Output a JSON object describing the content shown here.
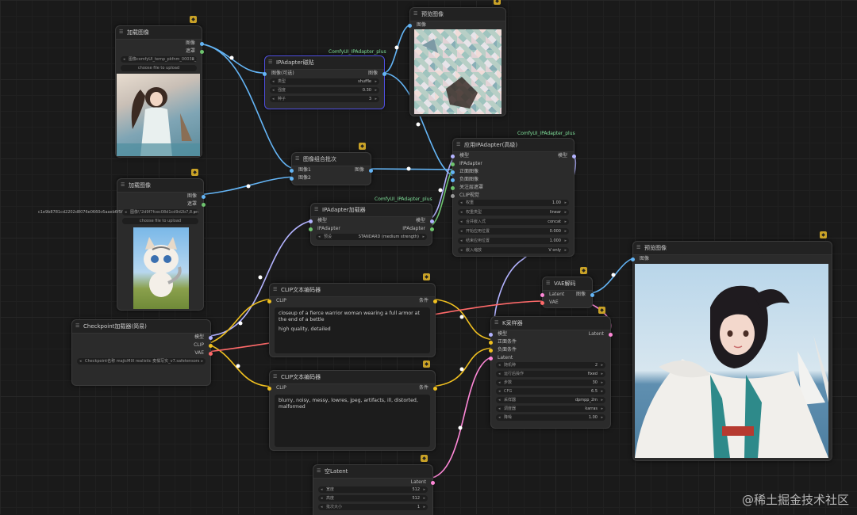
{
  "nodes": {
    "load1": {
      "title": "加载图像",
      "outputs": [
        "图像",
        "遮罩"
      ],
      "file": "图像comfyUI_temp_pkfnm_00038_.png",
      "upload": "choose file to upload"
    },
    "load2": {
      "title": "加载图像",
      "outputs": [
        "图像",
        "遮罩"
      ],
      "file_overflow": "c1e9b8781cd2202d8076e0660c6aaeb6f5f8a6",
      "file": "图像\\\"2d9f7fcec08d1cd9d2b7,8.png",
      "upload": "choose file to upload"
    },
    "preview1": {
      "title": "预览图像",
      "input": "图像"
    },
    "preview2": {
      "title": "预览图像",
      "input": "图像"
    },
    "ipa_tile": {
      "title": "IPAdapter磁贴",
      "tag": "ComfyUI_IPAdapter_plus",
      "input": "图像(可选)",
      "output": "图像",
      "widgets": [
        {
          "label": "类型",
          "value": "shuffle"
        },
        {
          "label": "强度",
          "value": "0.30"
        },
        {
          "label": "种子",
          "value": "3"
        }
      ]
    },
    "batch": {
      "title": "图像组合批次",
      "inputs": [
        "图像1",
        "图像2"
      ],
      "output": "图像"
    },
    "ipa_adv": {
      "title": "应用IPAdapter(高级)",
      "tag": "ComfyUI_IPAdapter_plus",
      "inputs": [
        "模型",
        "IPAdapter",
        "正面图像",
        "负面图像",
        "关注层遮罩",
        "CLIP视觉"
      ],
      "output": "模型",
      "widgets": [
        {
          "label": "权重",
          "value": "1.00"
        },
        {
          "label": "权重类型",
          "value": "linear"
        },
        {
          "label": "合并嵌入式",
          "value": "concat"
        },
        {
          "label": "开始应用位置",
          "value": "0.000"
        },
        {
          "label": "结束应用位置",
          "value": "1.000"
        },
        {
          "label": "嵌入缩放",
          "value": "V only"
        }
      ]
    },
    "ipa_loader": {
      "title": "IPAdapter加载器",
      "tag": "ComfyUI_IPAdapter_plus",
      "inputs": [
        "模型",
        "IPAdapter"
      ],
      "outputs": [
        "模型",
        "IPAdapter"
      ],
      "widgets": [
        {
          "label": "预设",
          "value": "STANDARD (medium strength)"
        }
      ]
    },
    "ckpt": {
      "title": "Checkpoint加载器(简易)",
      "outputs": [
        "模型",
        "CLIP",
        "VAE"
      ],
      "widget": "Checkpoint名称  majicMIX realistic 麦橘写实_v7.safetensors"
    },
    "clip_pos": {
      "title": "CLIP文本编码器",
      "input": "CLIP",
      "output": "条件",
      "text": "closeup of a fierce warrior woman wearing a full armor at the end of a bettle",
      "text2": "high quality, detailed"
    },
    "clip_neg": {
      "title": "CLIP文本编码器",
      "input": "CLIP",
      "output": "条件",
      "text": "blurry, noisy, messy, lowres, jpeg, artifacts, ill, distorted, malformed"
    },
    "vae": {
      "title": "VAE解码",
      "inputs": [
        "Latent",
        "VAE"
      ],
      "output": "图像"
    },
    "ksampler": {
      "title": "K采样器",
      "inputs": [
        "模型",
        "正面条件",
        "负面条件",
        "Latent"
      ],
      "output": "Latent",
      "widgets": [
        {
          "label": "随机种",
          "value": "2"
        },
        {
          "label": "运行后操作",
          "value": "fixed"
        },
        {
          "label": "步数",
          "value": "30"
        },
        {
          "label": "CFG",
          "value": "6.5"
        },
        {
          "label": "采样器",
          "value": "dpmpp_2m"
        },
        {
          "label": "调度器",
          "value": "karras"
        },
        {
          "label": "降噪",
          "value": "1.00"
        }
      ]
    },
    "latent": {
      "title": "空Latent",
      "output": "Latent",
      "widgets": [
        {
          "label": "宽度",
          "value": "512"
        },
        {
          "label": "高度",
          "value": "512"
        },
        {
          "label": "批次大小",
          "value": "1"
        }
      ]
    }
  },
  "watermark": "@稀土掘金技术社区",
  "colors": {
    "model": "#b3b3ff",
    "clip": "#f0c020",
    "vae": "#ff6a6a",
    "latent": "#ff88d8",
    "image": "#64b5f6",
    "mask": "#6ec46e",
    "selected": "#4f4fe0"
  }
}
